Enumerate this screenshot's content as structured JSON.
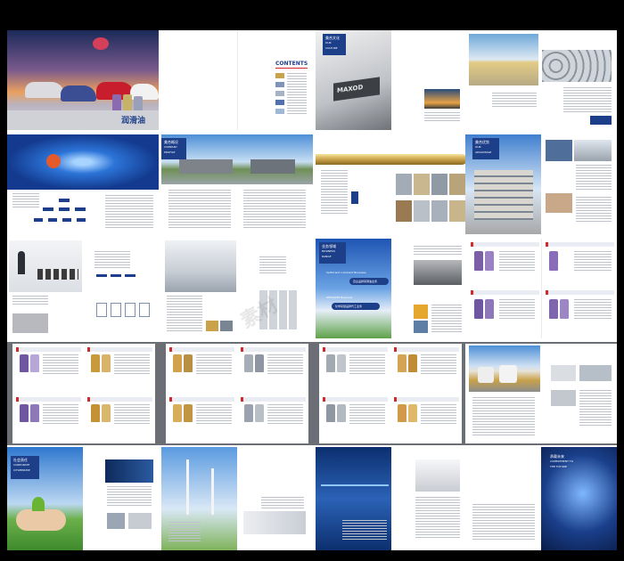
{
  "brochure": {
    "cover_title": "润滑油",
    "contents_title": "CONTENTS",
    "culture_cn": "美合文化",
    "culture_en": "OUR CULTURE",
    "profile_cn": "美合概况",
    "profile_en": "COMPANY PROFILE",
    "advantage_cn": "美合优势",
    "advantage_en": "OUR ADVANTAGE",
    "business_cn": "业务领域",
    "business_en": "BUSINESS RANGE",
    "business_tag1": "Self-brand Lubricant Business",
    "business_tag2": "自主品牌润滑油业务",
    "business_tag3": "OEM/ODM Business",
    "business_tag4": "化学初级品牌代工业务",
    "citizen_cn": "社会责任",
    "citizen_en": "CORPORATE CITIZENSHIP",
    "future_cn": "承载未来",
    "future_en": "COMMITMENT TO THE FUTURE",
    "logo_letters": "MAXOD"
  },
  "colors": {
    "navy": "#1d3f8a",
    "red": "#d02a2a",
    "gold": "#c9a24a",
    "sky": "#7fb3e6",
    "gray_band": "#6b6e74"
  }
}
